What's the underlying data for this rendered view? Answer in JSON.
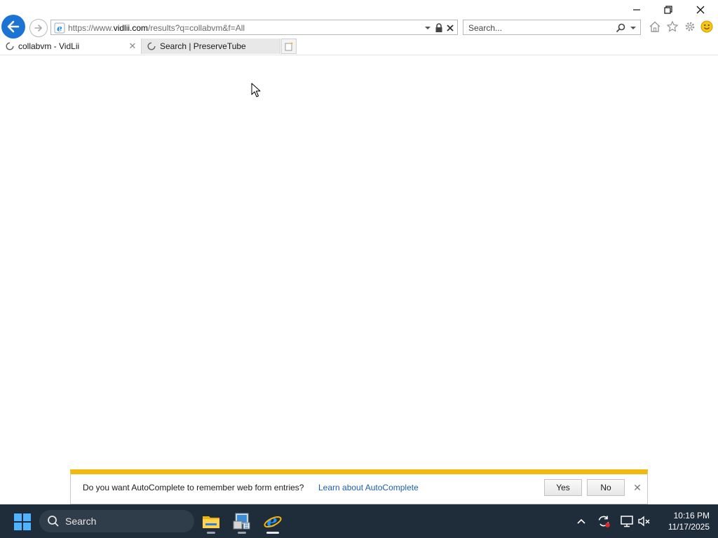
{
  "browser": {
    "address": {
      "prefix": "https://www.",
      "domain": "vidlii.com",
      "path": "/results?q=collabvm&f=All"
    },
    "search": {
      "placeholder": "Search..."
    },
    "tabs": [
      {
        "title": "collabvm - VidLii",
        "active": true,
        "loading": true
      },
      {
        "title": "Search | PreserveTube",
        "active": false,
        "loading": true
      }
    ],
    "toolbar_icons": [
      "home-icon",
      "favorites-star-icon",
      "settings-gear-icon",
      "feedback-smiley-icon"
    ]
  },
  "notification": {
    "message": "Do you want AutoComplete to remember web form entries?",
    "link": "Learn about AutoComplete",
    "yes_label": "Yes",
    "no_label": "No",
    "accent": "#f2b90f"
  },
  "taskbar": {
    "search_label": "Search",
    "apps": [
      "file-explorer-icon",
      "control-panel-icon",
      "internet-explorer-icon"
    ],
    "time": "10:16 PM",
    "date": "11/17/2025"
  },
  "colors": {
    "back_button": "#1b73d3",
    "taskbar": "#1f2d3b",
    "link": "#1d5fb0"
  }
}
